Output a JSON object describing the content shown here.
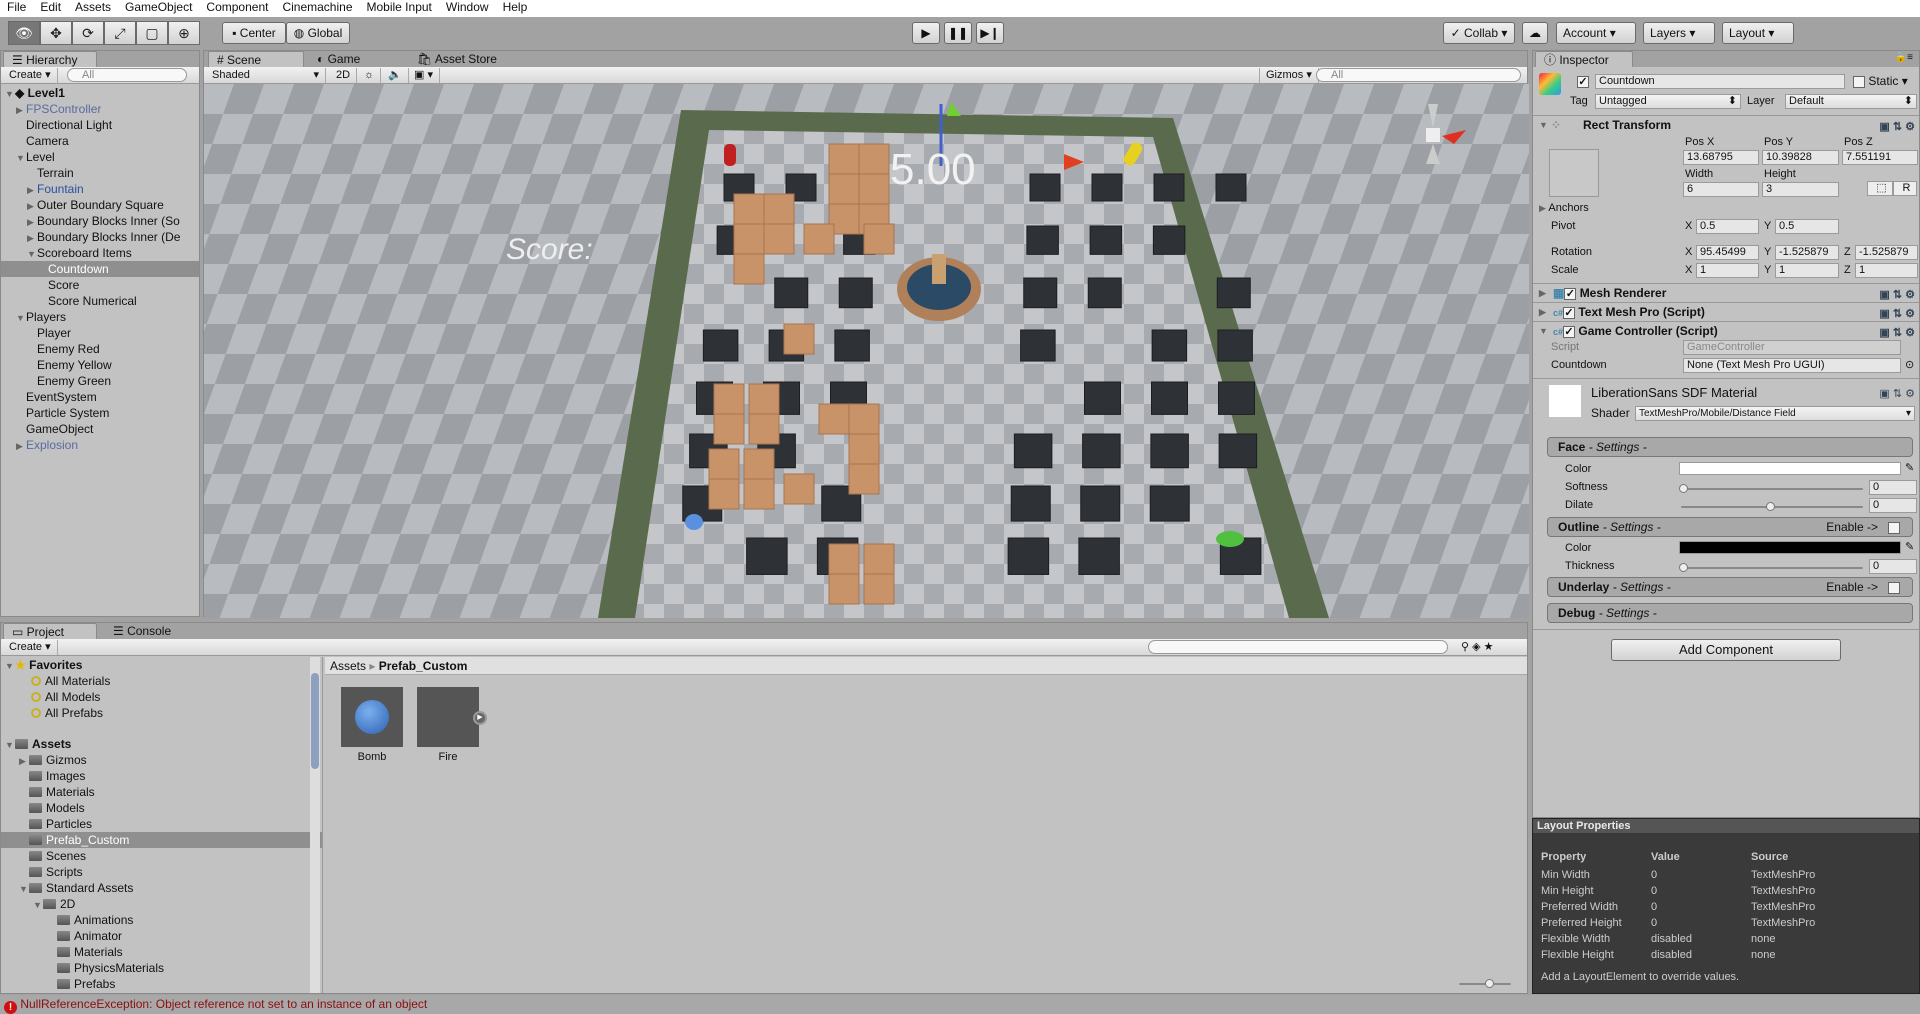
{
  "menu": [
    "File",
    "Edit",
    "Assets",
    "GameObject",
    "Component",
    "Cinemachine",
    "Mobile Input",
    "Window",
    "Help"
  ],
  "toolbar": {
    "tools": [
      "view-tool",
      "move-tool",
      "rotate-tool",
      "scale-tool",
      "rect-tool",
      "transform-tool"
    ],
    "pivot_mode": "Center",
    "pivot_rotation": "Global",
    "collab": "Collab",
    "account": "Account",
    "layers": "Layers",
    "layout": "Layout"
  },
  "hierarchy": {
    "tab": "Hierarchy",
    "create": "Create",
    "search_placeholder": "All",
    "scene": "Level1",
    "items": [
      {
        "label": "FPSController",
        "depth": 1,
        "arrow": "collapsed",
        "style": "prefab-dim"
      },
      {
        "label": "Directional Light",
        "depth": 1,
        "arrow": "none"
      },
      {
        "label": "Camera",
        "depth": 1,
        "arrow": "none"
      },
      {
        "label": "Level",
        "depth": 1,
        "arrow": "expanded"
      },
      {
        "label": "Terrain",
        "depth": 2,
        "arrow": "none"
      },
      {
        "label": "Fountain",
        "depth": 2,
        "arrow": "collapsed",
        "style": "prefab"
      },
      {
        "label": "Outer Boundary Square",
        "depth": 2,
        "arrow": "collapsed"
      },
      {
        "label": "Boundary Blocks Inner (So",
        "depth": 2,
        "arrow": "collapsed"
      },
      {
        "label": "Boundary Blocks Inner (De",
        "depth": 2,
        "arrow": "collapsed"
      },
      {
        "label": "Scoreboard Items",
        "depth": 2,
        "arrow": "expanded"
      },
      {
        "label": "Countdown",
        "depth": 3,
        "arrow": "none",
        "selected": true
      },
      {
        "label": "Score",
        "depth": 3,
        "arrow": "none"
      },
      {
        "label": "Score Numerical",
        "depth": 3,
        "arrow": "none"
      },
      {
        "label": "Players",
        "depth": 1,
        "arrow": "expanded"
      },
      {
        "label": "Player",
        "depth": 2,
        "arrow": "none"
      },
      {
        "label": "Enemy Red",
        "depth": 2,
        "arrow": "none"
      },
      {
        "label": "Enemy Yellow",
        "depth": 2,
        "arrow": "none"
      },
      {
        "label": "Enemy Green",
        "depth": 2,
        "arrow": "none"
      },
      {
        "label": "EventSystem",
        "depth": 1,
        "arrow": "none"
      },
      {
        "label": "Particle System",
        "depth": 1,
        "arrow": "none"
      },
      {
        "label": "GameObject",
        "depth": 1,
        "arrow": "none"
      },
      {
        "label": "Explosion",
        "depth": 1,
        "arrow": "collapsed",
        "style": "prefab-dim"
      }
    ]
  },
  "scene": {
    "tabs": [
      "Scene",
      "Game",
      "Asset Store"
    ],
    "shading": "Shaded",
    "mode_2d": "2D",
    "gizmos": "Gizmos",
    "search_placeholder": "All",
    "score_text": "Score:",
    "countdown_text": "5.00",
    "wall_color": "#5a6a4c"
  },
  "inspector": {
    "tab": "Inspector",
    "object_name": "Countdown",
    "active": true,
    "static_label": "Static",
    "tag_label": "Tag",
    "tag": "Untagged",
    "layer_label": "Layer",
    "layer": "Default",
    "rect_transform": {
      "title": "Rect Transform",
      "pos_x_label": "Pos X",
      "pos_y_label": "Pos Y",
      "pos_z_label": "Pos Z",
      "pos_x": "13.68795",
      "pos_y": "10.39828",
      "pos_z": "7.551191",
      "width_label": "Width",
      "height_label": "Height",
      "width": "6",
      "height": "3",
      "r_button": "R",
      "anchors_label": "Anchors",
      "pivot_label": "Pivot",
      "pivot_x": "0.5",
      "pivot_y": "0.5",
      "rotation_label": "Rotation",
      "rot_x": "95.45499",
      "rot_y": "-1.525879",
      "rot_z": "-1.525879",
      "scale_label": "Scale",
      "scale_x": "1",
      "scale_y": "1",
      "scale_z": "1",
      "x": "X",
      "y": "Y",
      "z": "Z"
    },
    "components": [
      "Mesh Renderer",
      "Text Mesh Pro (Script)",
      "Game Controller (Script)"
    ],
    "game_controller": {
      "script_label": "Script",
      "script": "GameController",
      "countdown_label": "Countdown",
      "countdown": "None (Text Mesh Pro UGUI)"
    },
    "material": {
      "name": "LiberationSans SDF Material",
      "shader_label": "Shader",
      "shader": "TextMeshPro/Mobile/Distance Field"
    },
    "face": {
      "title": "Face",
      "suffix": "- Settings -",
      "color_label": "Color",
      "color": "#ffffff",
      "softness_label": "Softness",
      "softness": "0",
      "softness_frac": 0,
      "dilate_label": "Dilate",
      "dilate": "0",
      "dilate_frac": 0.5
    },
    "outline": {
      "title": "Outline",
      "suffix": "- Settings -",
      "enable": "Enable ->",
      "color_label": "Color",
      "color": "#000000",
      "thickness_label": "Thickness",
      "thickness": "0",
      "thickness_frac": 0
    },
    "underlay": {
      "title": "Underlay",
      "suffix": "- Settings -",
      "enable": "Enable ->"
    },
    "debug": {
      "title": "Debug",
      "suffix": "- Settings -"
    },
    "add_component": "Add Component"
  },
  "layout_properties": {
    "title": "Layout Properties",
    "headers": [
      "Property",
      "Value",
      "Source"
    ],
    "rows": [
      [
        "Min Width",
        "0",
        "TextMeshPro"
      ],
      [
        "Min Height",
        "0",
        "TextMeshPro"
      ],
      [
        "Preferred Width",
        "0",
        "TextMeshPro"
      ],
      [
        "Preferred Height",
        "0",
        "TextMeshPro"
      ],
      [
        "Flexible Width",
        "disabled",
        "none"
      ],
      [
        "Flexible Height",
        "disabled",
        "none"
      ]
    ],
    "note": "Add a LayoutElement to override values."
  },
  "project": {
    "tabs": [
      "Project",
      "Console"
    ],
    "create": "Create",
    "favorites_label": "Favorites",
    "favorites": [
      "All Materials",
      "All Models",
      "All Prefabs"
    ],
    "assets_label": "Assets",
    "tree": [
      {
        "label": "Gizmos",
        "depth": 1,
        "arrow": "collapsed"
      },
      {
        "label": "Images",
        "depth": 1,
        "arrow": "none"
      },
      {
        "label": "Materials",
        "depth": 1,
        "arrow": "none"
      },
      {
        "label": "Models",
        "depth": 1,
        "arrow": "none"
      },
      {
        "label": "Particles",
        "depth": 1,
        "arrow": "none"
      },
      {
        "label": "Prefab_Custom",
        "depth": 1,
        "arrow": "none",
        "selected": true
      },
      {
        "label": "Scenes",
        "depth": 1,
        "arrow": "none"
      },
      {
        "label": "Scripts",
        "depth": 1,
        "arrow": "none"
      },
      {
        "label": "Standard Assets",
        "depth": 1,
        "arrow": "expanded"
      },
      {
        "label": "2D",
        "depth": 2,
        "arrow": "expanded"
      },
      {
        "label": "Animations",
        "depth": 3,
        "arrow": "none"
      },
      {
        "label": "Animator",
        "depth": 3,
        "arrow": "none"
      },
      {
        "label": "Materials",
        "depth": 3,
        "arrow": "none"
      },
      {
        "label": "PhysicsMaterials",
        "depth": 3,
        "arrow": "none"
      },
      {
        "label": "Prefabs",
        "depth": 3,
        "arrow": "none"
      }
    ],
    "breadcrumb": [
      "Assets",
      "Prefab_Custom"
    ],
    "assets": [
      {
        "name": "Bomb",
        "thumb": "blue-sphere"
      },
      {
        "name": "Fire",
        "thumb": "particle"
      }
    ]
  },
  "status": {
    "message": "NullReferenceException: Object reference not set to an instance of an object",
    "color": "#8a1010"
  }
}
